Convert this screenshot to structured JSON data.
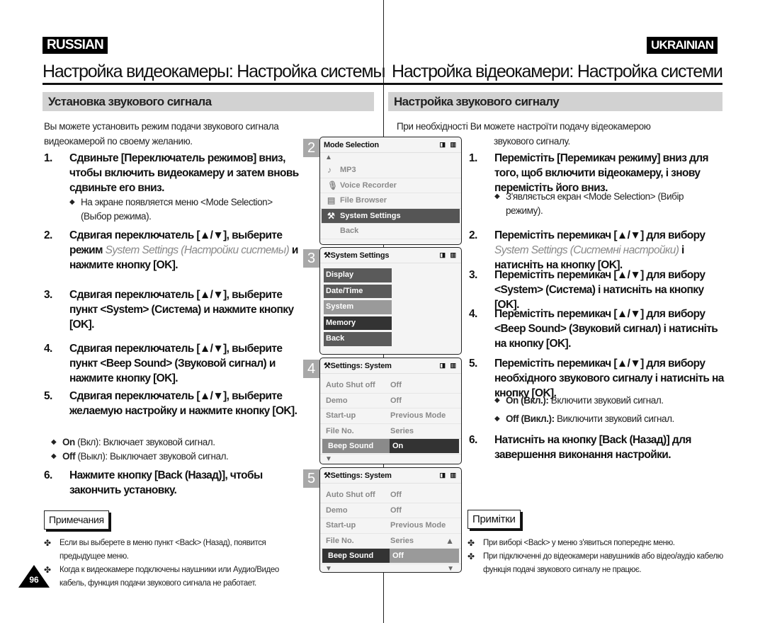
{
  "page_number": "96",
  "ru": {
    "lang": "RUSSIAN",
    "title": "Настройка видеокамеры: Настройка системы",
    "section": "Установка звукового сигнала",
    "intro": [
      "Вы можете установить режим подачи звукового сигнала",
      "видеокамерой по своему желанию."
    ],
    "steps": [
      {
        "num": "1.",
        "parts": [
          "Сдвиньте [Переключатель режимов] вниз, чтобы включить видеокамеру и затем вновь сдвиньте его вниз."
        ]
      },
      {
        "num": "2.",
        "parts": [
          "Сдвигая переключатель [▲/▼], выберите режим ",
          "System Settings (Настройки системы)",
          " и нажмите кнопку [OK]."
        ]
      },
      {
        "num": "3.",
        "parts": [
          "Сдвигая переключатель [▲/▼], выберите пункт <System> (Система) и нажмите кнопку [OK]."
        ]
      },
      {
        "num": "4.",
        "parts": [
          "Сдвигая переключатель [▲/▼], выберите пункт <Beep Sound> (Звуковой сигнал) и нажмите кнопку [OK]."
        ]
      },
      {
        "num": "5.",
        "parts": [
          "Сдвигая переключатель [▲/▼], выберите желаемую настройку и нажмите кнопку [OK]."
        ]
      },
      {
        "num": "6.",
        "parts": [
          "Нажмите кнопку [Back (Назад)], чтобы закончить установку."
        ]
      }
    ],
    "bullets": [
      {
        "bold": "",
        "text": "На экране появляется меню <Mode Selection> (Выбор режима)."
      },
      {
        "bold": "On",
        "text": " (Вкл): Включает звуковой сигнал."
      },
      {
        "bold": "Off",
        "text": " (Выкл): Выключает звуковой сигнал."
      }
    ],
    "notes_label": "Примечания",
    "notes": [
      "Если вы выберете в меню пункт <Back> (Назад), появится предыдущее меню.",
      "Когда к видеокамере подключены наушники или Аудио/Видео кабель, функция подачи звукового сигнала не работает."
    ]
  },
  "uk": {
    "lang": "UKRAINIAN",
    "title": "Настройка відеокамери: Настройка системи",
    "section": "Настройка звукового сигналу",
    "intro": [
      "При необхідності Ви можете настроїти подачу відеокамерою",
      "звукового сигналу."
    ],
    "steps": [
      {
        "num": "1.",
        "parts": [
          "Перемістіть [Перемикач режиму] вниз для того, щоб включити відеокамеру, і знову перемістіть його вниз."
        ]
      },
      {
        "num": "2.",
        "parts": [
          "Перемістіть перемикач [▲/▼] для вибору ",
          "System Settings (Системні настройки)",
          " і натисніть на кнопку [OK]."
        ]
      },
      {
        "num": "3.",
        "parts": [
          "Перемістіть перемикач [▲/▼] для вибору <System> (Система) і натисніть на кнопку [OK]."
        ]
      },
      {
        "num": "4.",
        "parts": [
          "Перемістіть перемикач [▲/▼] для вибору <Beep Sound> (Звуковий сигнал) і натисніть на кнопку [OK]."
        ]
      },
      {
        "num": "5.",
        "parts": [
          "Перемістіть перемикач [▲/▼] для вибору необхідного звукового сигналу і натисніть на кнопку [OK]."
        ]
      },
      {
        "num": "6.",
        "parts": [
          "Натисніть на кнопку [Back (Назад)] для завершення виконання настройки."
        ]
      }
    ],
    "bullets": [
      {
        "bold": "",
        "text": "З'являється екран <Mode Selection> (Вибір режиму)."
      },
      {
        "bold": "On (Вкл.):",
        "text": " Включити звуковий сигнал."
      },
      {
        "bold": "Off (Викл.):",
        "text": " Виключити звуковий сигнал."
      }
    ],
    "notes_label": "Примітки",
    "notes": [
      "При виборі <Back> у меню з'явиться попереднє меню.",
      "При підключенні до відеокамери навушників або відео/аудіо кабелю функція подачі звукового сигналу не працює."
    ]
  },
  "screens": [
    {
      "step": "2",
      "title": "Mode Selection",
      "type": "menu",
      "items": [
        {
          "icon": "♪",
          "label": "MP3"
        },
        {
          "icon": "🎙",
          "label": "Voice Recorder"
        },
        {
          "icon": "▤",
          "label": "File Browser"
        },
        {
          "icon": "⚒",
          "label": "System Settings",
          "selected": true
        },
        {
          "icon": "",
          "label": "Back"
        }
      ]
    },
    {
      "step": "3",
      "title": "System Settings",
      "type": "buttons",
      "items": [
        {
          "label": "Display",
          "color": "#5a5a5a"
        },
        {
          "label": "Date/Time",
          "color": "#5a5a5a"
        },
        {
          "label": "System",
          "color": "#9a9a9a"
        },
        {
          "label": "Memory",
          "color": "#333333"
        },
        {
          "label": "Back",
          "color": "#5a5a5a"
        }
      ]
    },
    {
      "step": "4",
      "title": "Settings: System",
      "type": "kv",
      "rows": [
        [
          "Auto Shut off",
          "Off"
        ],
        [
          "Demo",
          "Off"
        ],
        [
          "Start-up",
          "Previous Mode"
        ],
        [
          "File No.",
          "Series"
        ],
        [
          "Beep Sound",
          "On"
        ]
      ],
      "sel_label_color": "#8a8a8a",
      "sel_value_color": "#333333"
    },
    {
      "step": "5",
      "title": "Settings: System",
      "type": "kv",
      "rows": [
        [
          "Auto Shut off",
          "Off"
        ],
        [
          "Demo",
          "Off"
        ],
        [
          "Start-up",
          "Previous Mode"
        ],
        [
          "File No.",
          "Series"
        ],
        [
          "Beep Sound",
          "Off"
        ]
      ],
      "sel_label_color": "#333333",
      "sel_value_color": "#9a9a9a"
    }
  ]
}
